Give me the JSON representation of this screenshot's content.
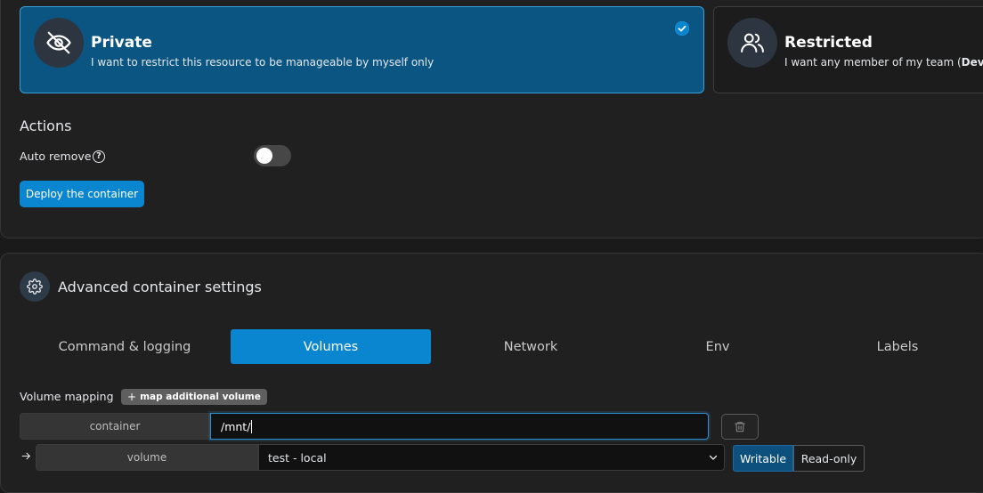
{
  "access": {
    "private": {
      "title": "Private",
      "description": "I want to restrict this resource to be manageable by myself only",
      "selected": true
    },
    "restricted": {
      "title": "Restricted",
      "description_prefix": "I want any member of my team (",
      "description_bold": "Develo"
    }
  },
  "actions": {
    "title": "Actions",
    "auto_remove_label": "Auto remove",
    "help_glyph": "?",
    "auto_remove_enabled": false,
    "deploy_label": "Deploy the container"
  },
  "advanced": {
    "title": "Advanced container settings",
    "tabs": [
      {
        "label": "Command & logging",
        "active": false
      },
      {
        "label": "Volumes",
        "active": true
      },
      {
        "label": "Network",
        "active": false
      },
      {
        "label": "Env",
        "active": false
      },
      {
        "label": "Labels",
        "active": false
      }
    ]
  },
  "volumes": {
    "mapping_label": "Volume mapping",
    "add_button_icon": "+",
    "add_button_label": "map additional volume",
    "container_addon": "container",
    "container_value": "/mnt/",
    "volume_addon": "volume",
    "volume_selected": "test - local",
    "mode_writable": "Writable",
    "mode_readonly": "Read-only",
    "selected_mode": "Writable"
  },
  "colors": {
    "accent": "#0a86d0",
    "private_card_bg": "#0b5582",
    "panel_bg": "#202020",
    "page_bg": "#1a1a1a"
  }
}
